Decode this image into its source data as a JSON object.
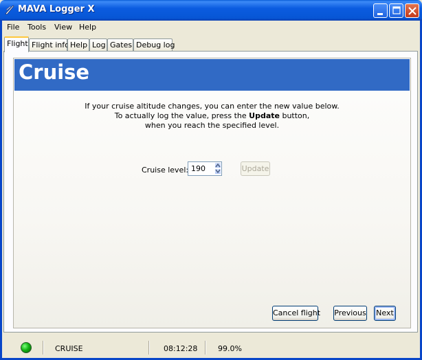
{
  "window": {
    "title": "MAVA Logger X"
  },
  "menu": [
    "File",
    "Tools",
    "View",
    "Help"
  ],
  "tabs": [
    "Flight",
    "Flight info",
    "Help",
    "Log",
    "Gates",
    "Debug log"
  ],
  "active_tab": "Flight",
  "page": {
    "heading": "Cruise",
    "line1": "If your cruise altitude changes, you can enter the new value below.",
    "line2_pre": "To actually log the value, press the ",
    "line2_bold": "Update",
    "line2_post": " button,",
    "line3": "when you reach the specified level."
  },
  "form": {
    "cruise_label": "Cruise level:",
    "cruise_value": "190",
    "update_label": "Update",
    "update_enabled": false
  },
  "buttons": {
    "cancel": "Cancel flight",
    "previous": "Previous",
    "next": "Next"
  },
  "status": {
    "indicator_color": "#15b515",
    "phase": "CRUISE",
    "time": "08:12:28",
    "percent": "99.0%"
  }
}
